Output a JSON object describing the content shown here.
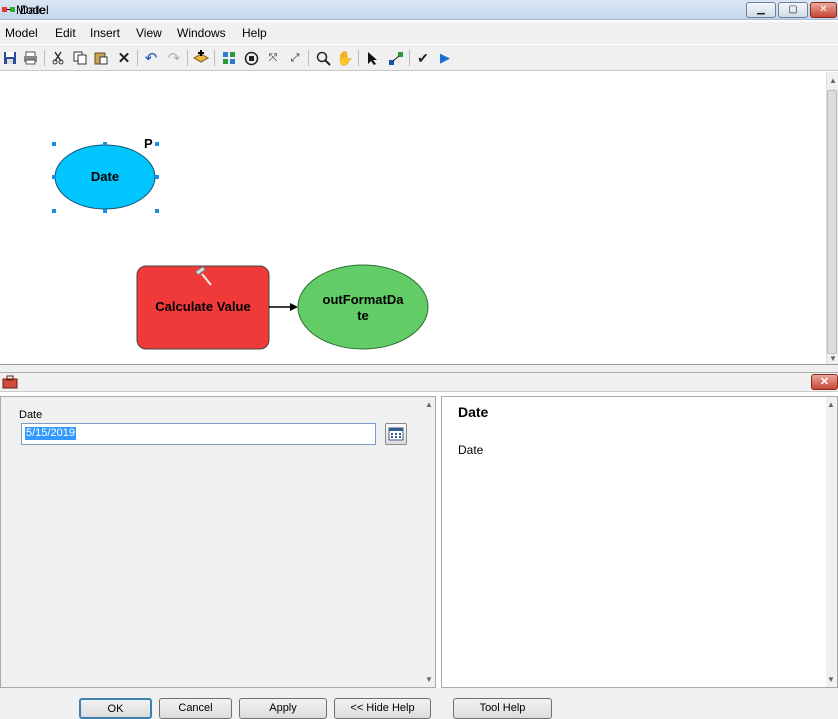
{
  "app": {
    "title": "Model"
  },
  "window_buttons": {
    "minimize": "▁",
    "maximize": "▢",
    "close": "✕"
  },
  "menu": [
    "Model",
    "Edit",
    "Insert",
    "View",
    "Windows",
    "Help"
  ],
  "toolbar": {
    "icons": [
      "save-icon",
      "print-icon",
      "cut-icon",
      "copy-icon",
      "paste-icon",
      "delete-icon",
      "undo-icon",
      "redo-icon",
      "add-data-icon",
      "auto-layout-icon",
      "full-extent-icon",
      "fixed-zoom-in-icon",
      "fixed-zoom-out-icon",
      "zoom-icon",
      "pan-icon",
      "select-icon",
      "connect-icon",
      "validate-icon",
      "run-icon"
    ]
  },
  "model": {
    "date_node": {
      "label": "Date",
      "marker": "P",
      "color": "#00c5ff"
    },
    "calc_node": {
      "label": "Calculate Value",
      "color": "#f03a3a"
    },
    "output_node": {
      "label_line1": "outFormatDa",
      "label_line2": "te",
      "color": "#62cc66"
    }
  },
  "dialog": {
    "title": "Date",
    "close": "✕",
    "field_label": "Date",
    "field_value": "5/15/2019",
    "help_title": "Date",
    "help_text": "Date"
  },
  "buttons": {
    "ok": "OK",
    "cancel": "Cancel",
    "apply": "Apply",
    "hide_help": "<< Hide Help",
    "tool_help": "Tool Help"
  }
}
